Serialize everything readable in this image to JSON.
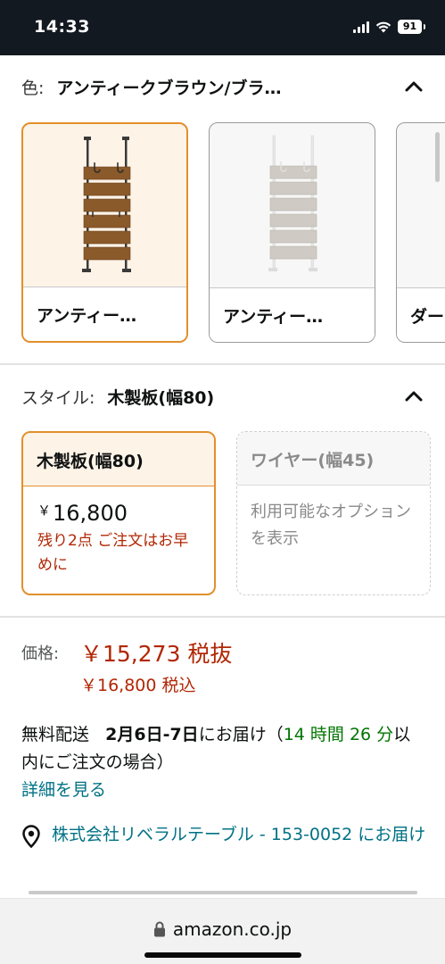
{
  "status_bar": {
    "time": "14:33",
    "battery": "91"
  },
  "color_section": {
    "label": "色:",
    "value": "アンティークブラウン/ブラ…",
    "options": [
      {
        "name": "アンティー…",
        "selected": true
      },
      {
        "name": "アンティー…",
        "selected": false
      },
      {
        "name": "ダー",
        "selected": false
      }
    ]
  },
  "style_section": {
    "label": "スタイル:",
    "value": "木製板(幅80)",
    "options": [
      {
        "title": "木製板(幅80)",
        "currency": "￥",
        "price": "16,800",
        "stock": "残り2点 ご注文はお早めに",
        "selected": true
      },
      {
        "title": "ワイヤー(幅45)",
        "note": "利用可能なオプションを表示",
        "selected": false
      }
    ]
  },
  "price": {
    "label": "価格:",
    "main": "￥15,273 税抜",
    "sub": "￥16,800 税込"
  },
  "delivery": {
    "prefix": "無料配送",
    "date": "2月6日-7日",
    "suffix": "にお届け（",
    "time": "14 時間 26 分",
    "tail": "以内にご注文の場合）",
    "details_link": "詳細を見る"
  },
  "location": {
    "text": "株式会社リベラルテーブル - 153-0052 にお届け"
  },
  "browser": {
    "url": "amazon.co.jp"
  },
  "colors": {
    "accent_orange": "#e2902c",
    "price_red": "#b12704",
    "link_teal": "#007185",
    "green": "#007600",
    "header_dark": "#131921"
  }
}
